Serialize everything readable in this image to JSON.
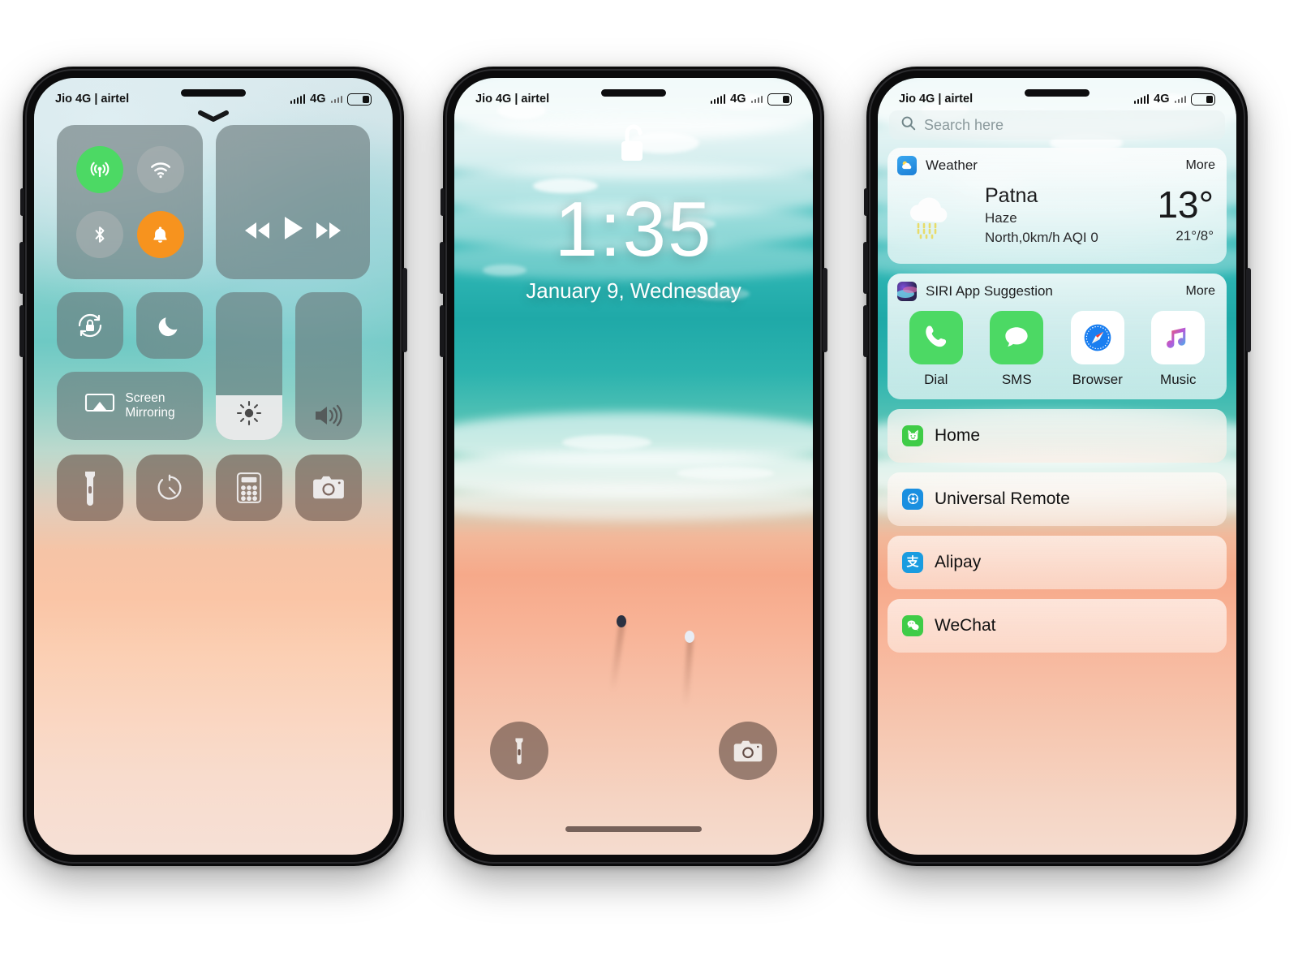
{
  "status_bar": {
    "carrier": "Jio 4G | airtel",
    "network": "4G",
    "signal_icon": "signal-bars-icon",
    "battery_icon": "battery-icon"
  },
  "phone_1_control_center": {
    "name": "Control Center",
    "earpiece_icon": "earpiece-speaker",
    "handle_icon": "chevron-down-icon",
    "connectivity": [
      {
        "name": "airplane-mode",
        "icon": "cellular-signal-icon",
        "state": "on",
        "color": "#4cd964"
      },
      {
        "name": "wifi",
        "icon": "wifi-icon",
        "state": "off",
        "color": "#aab2b2"
      },
      {
        "name": "bluetooth",
        "icon": "bluetooth-icon",
        "state": "off",
        "color": "#aab2b2"
      },
      {
        "name": "ringer",
        "icon": "bell-icon",
        "state": "on",
        "color": "#f7931e"
      }
    ],
    "media": [
      {
        "name": "rewind",
        "icon": "rewind-icon"
      },
      {
        "name": "play",
        "icon": "play-icon"
      },
      {
        "name": "fast-forward",
        "icon": "fast-forward-icon"
      }
    ],
    "toggles": [
      {
        "name": "rotation-lock",
        "icon": "rotation-lock-icon"
      },
      {
        "name": "do-not-disturb",
        "icon": "moon-icon"
      }
    ],
    "screen_mirroring": {
      "label_line1": "Screen",
      "label_line2": "Mirroring",
      "icon": "airplay-icon"
    },
    "sliders": [
      {
        "name": "brightness",
        "icon": "brightness-sun-icon",
        "value": 30
      },
      {
        "name": "volume",
        "icon": "volume-icon",
        "value": 0
      }
    ],
    "shortcuts": [
      {
        "name": "flashlight",
        "icon": "flashlight-icon"
      },
      {
        "name": "timer",
        "icon": "timer-icon"
      },
      {
        "name": "calculator",
        "icon": "calculator-icon"
      },
      {
        "name": "camera",
        "icon": "camera-icon"
      }
    ]
  },
  "phone_2_lock_screen": {
    "name": "Lock Screen",
    "padlock_icon": "unlocked-padlock-icon",
    "time": "1:35",
    "date": "January 9, Wednesday",
    "actions": [
      {
        "name": "flashlight",
        "icon": "flashlight-icon"
      },
      {
        "name": "camera",
        "icon": "camera-icon"
      }
    ],
    "home_indicator": "home-indicator-bar"
  },
  "phone_3_widgets": {
    "name": "Widgets / Search",
    "search": {
      "placeholder": "Search here",
      "icon": "search-icon"
    },
    "weather_card": {
      "title": "Weather",
      "more": "More",
      "app_icon": "weather-app-icon",
      "condition_icon": "haze-cloud-drizzle-icon",
      "city": "Patna",
      "condition": "Haze",
      "wind_aqi": "North,0km/h  AQI 0",
      "temperature": "13°",
      "high_low": "21°/8°"
    },
    "siri_card": {
      "title": "SIRI App Suggestion",
      "more": "More",
      "app_icon": "siri-icon",
      "apps": [
        {
          "label": "Dial",
          "icon": "phone-icon",
          "color": "#4cd964"
        },
        {
          "label": "SMS",
          "icon": "message-icon",
          "color": "#4cd964"
        },
        {
          "label": "Browser",
          "icon": "safari-compass-icon",
          "color": "#1a7ef0"
        },
        {
          "label": "Music",
          "icon": "music-note-icon",
          "color": "#ffffff"
        }
      ]
    },
    "app_list": [
      {
        "label": "Home",
        "icon": "home-cat-icon",
        "color": "#3fcc47"
      },
      {
        "label": "Universal Remote",
        "icon": "remote-icon",
        "color": "#1a8fe0"
      },
      {
        "label": "Alipay",
        "icon": "alipay-icon",
        "color": "#1a9ce0"
      },
      {
        "label": "WeChat",
        "icon": "wechat-icon",
        "color": "#3fcc47"
      }
    ]
  },
  "colors": {
    "accent_green": "#4cd964",
    "accent_orange": "#f7931e",
    "tile_gray": "rgba(104,118,120,.62)",
    "shortcut_brown": "rgba(108,84,74,.64)"
  }
}
